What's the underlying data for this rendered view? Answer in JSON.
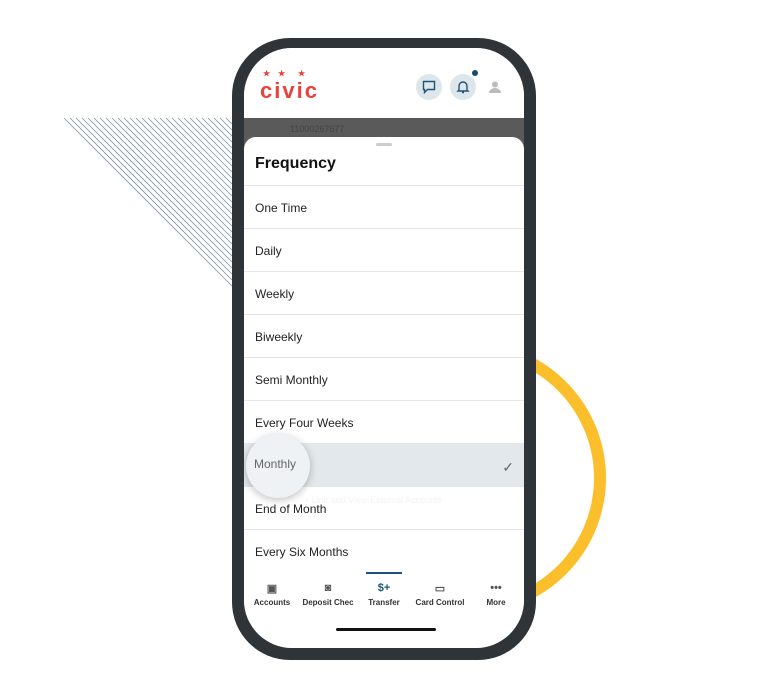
{
  "header": {
    "logo": "civic",
    "account_number": "11000267677",
    "ghost_text": "+ Link and View External Accounts"
  },
  "sheet": {
    "title": "Frequency",
    "selected": "Monthly",
    "options": [
      "One Time",
      "Daily",
      "Weekly",
      "Biweekly",
      "Semi Monthly",
      "Every Four Weeks",
      "Monthly",
      "End of Month",
      "Every Six Months"
    ]
  },
  "tabs": [
    {
      "label": "Accounts",
      "icon": "wallet-icon"
    },
    {
      "label": "Deposit Chec",
      "icon": "camera-icon"
    },
    {
      "label": "Transfer",
      "icon": "dollar-transfer-icon",
      "active": true
    },
    {
      "label": "Card Control",
      "icon": "card-icon"
    },
    {
      "label": "More",
      "icon": "more-icon"
    }
  ],
  "colors": {
    "brand": "#e8423d",
    "accent": "#1e5478",
    "ring": "#fbbf2c",
    "frame": "#2e3438"
  }
}
